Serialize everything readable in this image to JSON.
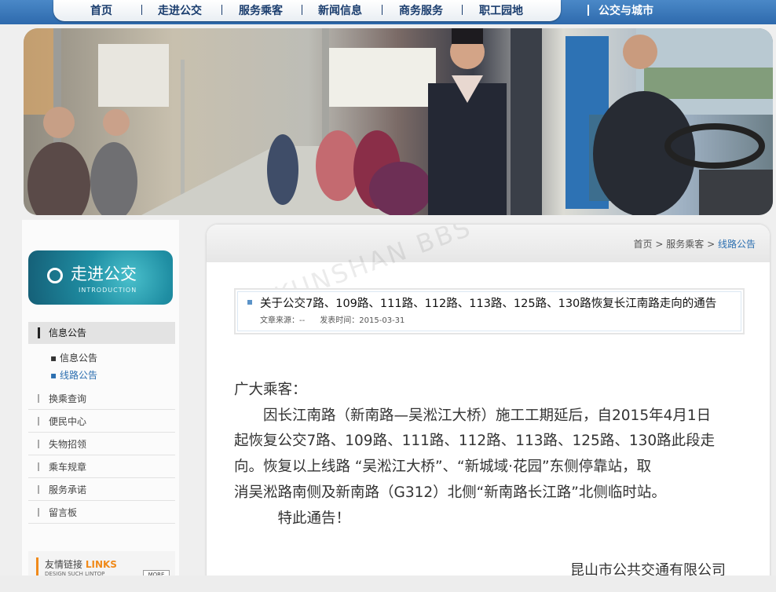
{
  "nav": {
    "items": [
      "首页",
      "走进公交",
      "服务乘客",
      "新闻信息",
      "商务服务",
      "职工园地"
    ],
    "extra": "公交与城市"
  },
  "sidebar": {
    "section_title": "走进公交",
    "section_subtitle": "INTRODUCTION",
    "active_item": "信息公告",
    "sub_items": [
      "信息公告",
      "线路公告"
    ],
    "menu_items": [
      "换乘查询",
      "便民中心",
      "失物招领",
      "乘车规章",
      "服务承诺",
      "留言板"
    ],
    "links_title": "友情链接",
    "links_title_en": "LINKS",
    "links_sub": "DESIGN SUCH LINTOP",
    "more_label": "MORE"
  },
  "breadcrumb": {
    "home": "首页",
    "parent": "服务乘客",
    "current": "线路公告"
  },
  "article": {
    "title": "关于公交7路、109路、111路、112路、113路、125路、130路恢复长江南路走向的通告",
    "source_label": "文章来源：--",
    "date_label": "发表时间：2015-03-31",
    "greeting": "广大乘客：",
    "paragraph_lines": [
      "　　因长江南路（新南路—吴淞江大桥）施工工期延后，自2015年4月1日",
      "起恢复公交7路、109路、111路、112路、113路、125路、130路此段走",
      "向。恢复以上线路 “吴淞江大桥”、“新城域·花园”东侧停靠站，取",
      "消吴淞路南侧及新南路（G312）北侧“新南路长江路”北侧临时站。",
      "　　　特此通告！"
    ],
    "signature": "昆山市公共交通有限公司"
  },
  "watermark": "KUNSHAN BBS",
  "colors": {
    "nav_blue": "#2e6aad",
    "accent_blue": "#2c6fb0",
    "links_orange": "#f08a1a"
  }
}
